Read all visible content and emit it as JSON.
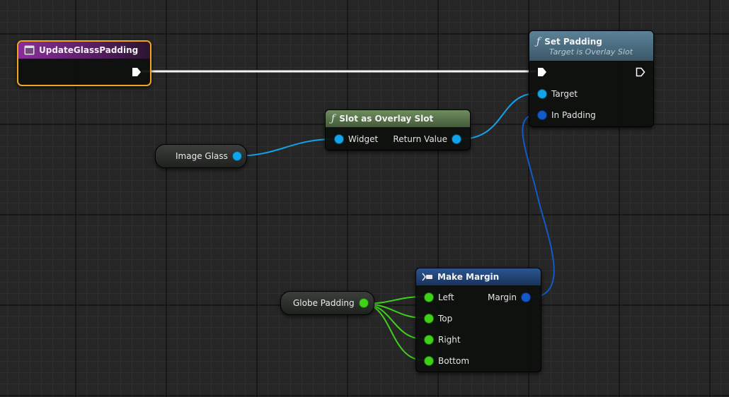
{
  "graph": {
    "event_node": {
      "title": "UpdateGlassPadding",
      "accent": "#7b2a8a",
      "selected_border": "#f1a521"
    },
    "set_padding": {
      "title": "Set Padding",
      "subtitle": "Target is Overlay Slot",
      "pins": {
        "target": "Target",
        "in_padding": "In Padding"
      }
    },
    "slot_as_overlay": {
      "title": "Slot as Overlay Slot",
      "pins": {
        "widget": "Widget",
        "return_value": "Return Value"
      }
    },
    "image_glass": {
      "label": "Image Glass"
    },
    "globe_padding": {
      "label": "Globe Padding"
    },
    "make_margin": {
      "title": "Make Margin",
      "pins": {
        "left": "Left",
        "top": "Top",
        "right": "Right",
        "bottom": "Bottom",
        "margin": "Margin"
      }
    }
  },
  "colors": {
    "exec_wire": "#ffffff",
    "object_pin": "#12a4e8",
    "struct_pin": "#1359c9",
    "float_pin": "#3fd11a",
    "function_header": "#4d6f85",
    "pure_function_header": "#5a7a4e",
    "make_struct_header": "#24467a"
  },
  "icons": {
    "event": "event-square-icon",
    "function": "function-f-icon",
    "make_struct": "make-struct-icon",
    "exec": "exec-arrow-icon"
  }
}
